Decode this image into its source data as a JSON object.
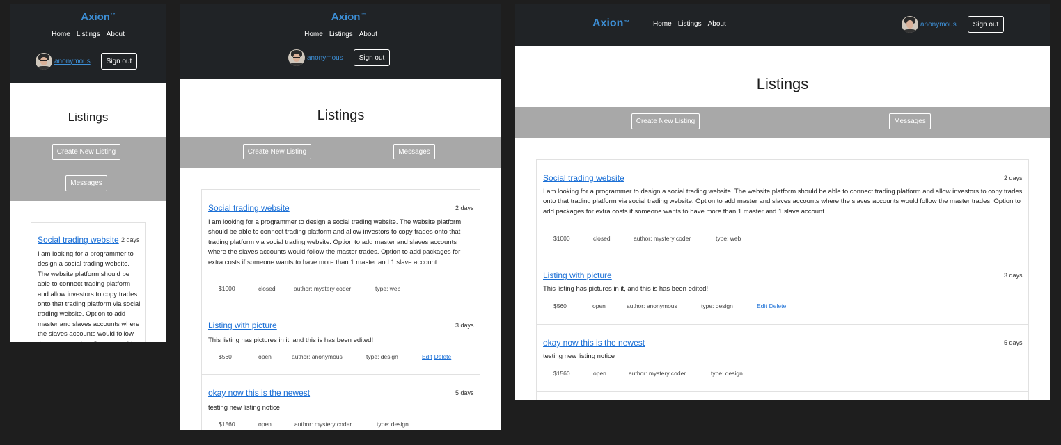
{
  "brand": "Axion",
  "brand_mark": "™",
  "nav": {
    "home": "Home",
    "listings": "Listings",
    "about": "About"
  },
  "user": {
    "name": "anonymous",
    "signout": "Sign out"
  },
  "page": {
    "title": "Listings",
    "create_button": "Create New Listing",
    "messages_button": "Messages"
  },
  "listings": [
    {
      "title": "Social trading website",
      "age": "2 days",
      "description": "I am looking for a programmer to design a social trading website. The website platform should be able to connect trading platform and allow investors to copy trades onto that trading platform via social trading website. Option to add master and slaves accounts where the slaves accounts would follow the master trades. Option to add packages for extra costs if someone wants to have more than 1 master and 1 slave account.",
      "price": "$1000",
      "status": "closed",
      "author": "author: mystery coder",
      "type": "type: web"
    },
    {
      "title": "Listing with picture",
      "age": "3 days",
      "description": "This listing has pictures in it, and this is has been edited!",
      "price": "$560",
      "status": "open",
      "author": "author: anonymous",
      "type": "type: design",
      "edit": "Edit",
      "delete": "Delete"
    },
    {
      "title": "okay now this is the newest",
      "age": "5 days",
      "description": "testing new listing notice",
      "price": "$1560",
      "status": "open",
      "author": "author: mystery coder",
      "type": "type: design"
    }
  ]
}
